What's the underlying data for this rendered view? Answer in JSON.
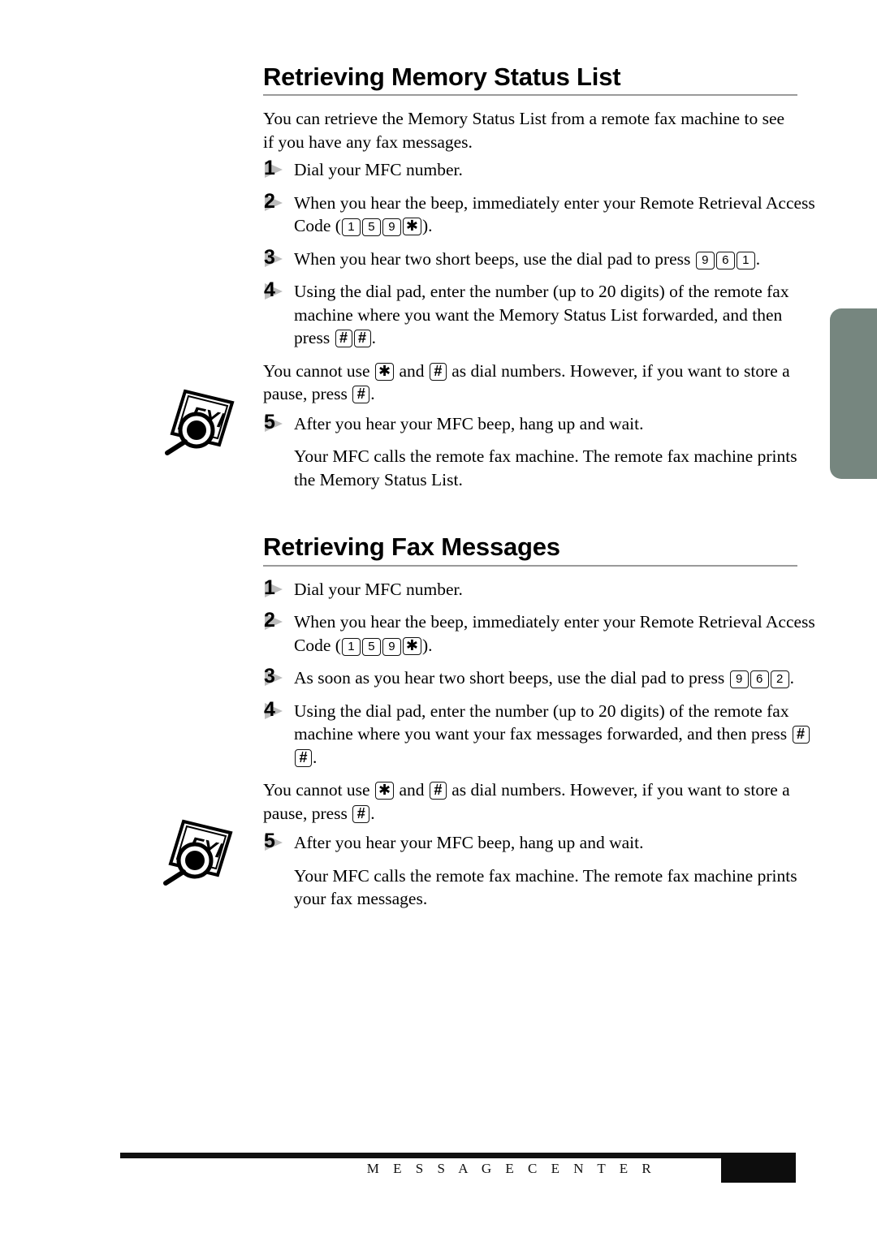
{
  "page": {
    "footer_label": "M E S S A G E   C E N T E R",
    "edge_tab_color": "#76867f",
    "rule_color": "#9a9a9a",
    "marker_color": "#bcbcbc"
  },
  "sections": [
    {
      "title": "Retrieving Memory Status List",
      "intro": "You can retrieve the Memory Status List from a remote fax machine to see if you have any fax messages.",
      "steps": [
        {
          "num": "1",
          "parts": [
            {
              "t": "text",
              "v": "Dial your MFC number."
            }
          ]
        },
        {
          "num": "2",
          "parts": [
            {
              "t": "text",
              "v": "When you hear the beep, immediately enter your Remote Retrieval Access Code ("
            },
            {
              "t": "key",
              "v": "1"
            },
            {
              "t": "key",
              "v": "5"
            },
            {
              "t": "key",
              "v": "9"
            },
            {
              "t": "key-sym",
              "v": "✳"
            },
            {
              "t": "text",
              "v": ")."
            }
          ]
        },
        {
          "num": "3",
          "parts": [
            {
              "t": "text",
              "v": "When you hear two short beeps, use the dial pad to press "
            },
            {
              "t": "key",
              "v": "9"
            },
            {
              "t": "key",
              "v": "6"
            },
            {
              "t": "key",
              "v": "1"
            },
            {
              "t": "text",
              "v": "."
            }
          ]
        },
        {
          "num": "4",
          "parts": [
            {
              "t": "text",
              "v": "Using the dial pad, enter the number (up to 20 digits) of the remote fax machine where you want the Memory Status List forwarded, and then press "
            },
            {
              "t": "key-sym",
              "v": "#"
            },
            {
              "t": "key-sym",
              "v": "#"
            },
            {
              "t": "text",
              "v": "."
            }
          ]
        }
      ],
      "note": {
        "icon": "fyi-icon",
        "parts": [
          {
            "t": "text",
            "v": "You cannot use "
          },
          {
            "t": "key-sym",
            "v": "✳"
          },
          {
            "t": "text",
            "v": " and "
          },
          {
            "t": "key-sym",
            "v": "#"
          },
          {
            "t": "text",
            "v": " as dial numbers. However, if you want to store a pause, press "
          },
          {
            "t": "key-sym",
            "v": "#"
          },
          {
            "t": "text",
            "v": "."
          }
        ]
      },
      "steps_after": [
        {
          "num": "5",
          "parts": [
            {
              "t": "text",
              "v": "After you hear your MFC beep, hang up and wait."
            }
          ]
        }
      ],
      "closing": "Your MFC calls the remote fax machine. The remote fax machine prints the Memory Status List."
    },
    {
      "title": "Retrieving Fax Messages",
      "intro": "",
      "steps": [
        {
          "num": "1",
          "parts": [
            {
              "t": "text",
              "v": "Dial your MFC number."
            }
          ]
        },
        {
          "num": "2",
          "parts": [
            {
              "t": "text",
              "v": "When you hear the beep, immediately enter your Remote Retrieval Access Code ("
            },
            {
              "t": "key",
              "v": "1"
            },
            {
              "t": "key",
              "v": "5"
            },
            {
              "t": "key",
              "v": "9"
            },
            {
              "t": "key-sym",
              "v": "✳"
            },
            {
              "t": "text",
              "v": ")."
            }
          ]
        },
        {
          "num": "3",
          "parts": [
            {
              "t": "text",
              "v": "As soon as you hear two short beeps, use the dial pad to press "
            },
            {
              "t": "key",
              "v": "9"
            },
            {
              "t": "key",
              "v": "6"
            },
            {
              "t": "key",
              "v": "2"
            },
            {
              "t": "text",
              "v": "."
            }
          ]
        },
        {
          "num": "4",
          "parts": [
            {
              "t": "text",
              "v": "Using the dial pad, enter the number (up to 20 digits) of the remote fax machine where you want your fax messages forwarded, and then press "
            },
            {
              "t": "key-sym",
              "v": "#"
            },
            {
              "t": "key-sym",
              "v": "#"
            },
            {
              "t": "text",
              "v": "."
            }
          ]
        }
      ],
      "note": {
        "icon": "fyi-icon",
        "parts": [
          {
            "t": "text",
            "v": "You cannot use "
          },
          {
            "t": "key-sym",
            "v": "✳"
          },
          {
            "t": "text",
            "v": " and "
          },
          {
            "t": "key-sym",
            "v": "#"
          },
          {
            "t": "text",
            "v": " as dial numbers.  However, if you want to store a pause, press "
          },
          {
            "t": "key-sym",
            "v": "#"
          },
          {
            "t": "text",
            "v": "."
          }
        ]
      },
      "steps_after": [
        {
          "num": "5",
          "parts": [
            {
              "t": "text",
              "v": "After you hear your MFC beep, hang up and wait."
            }
          ]
        }
      ],
      "closing": "Your MFC calls the remote fax machine. The remote fax machine prints your fax messages."
    }
  ]
}
